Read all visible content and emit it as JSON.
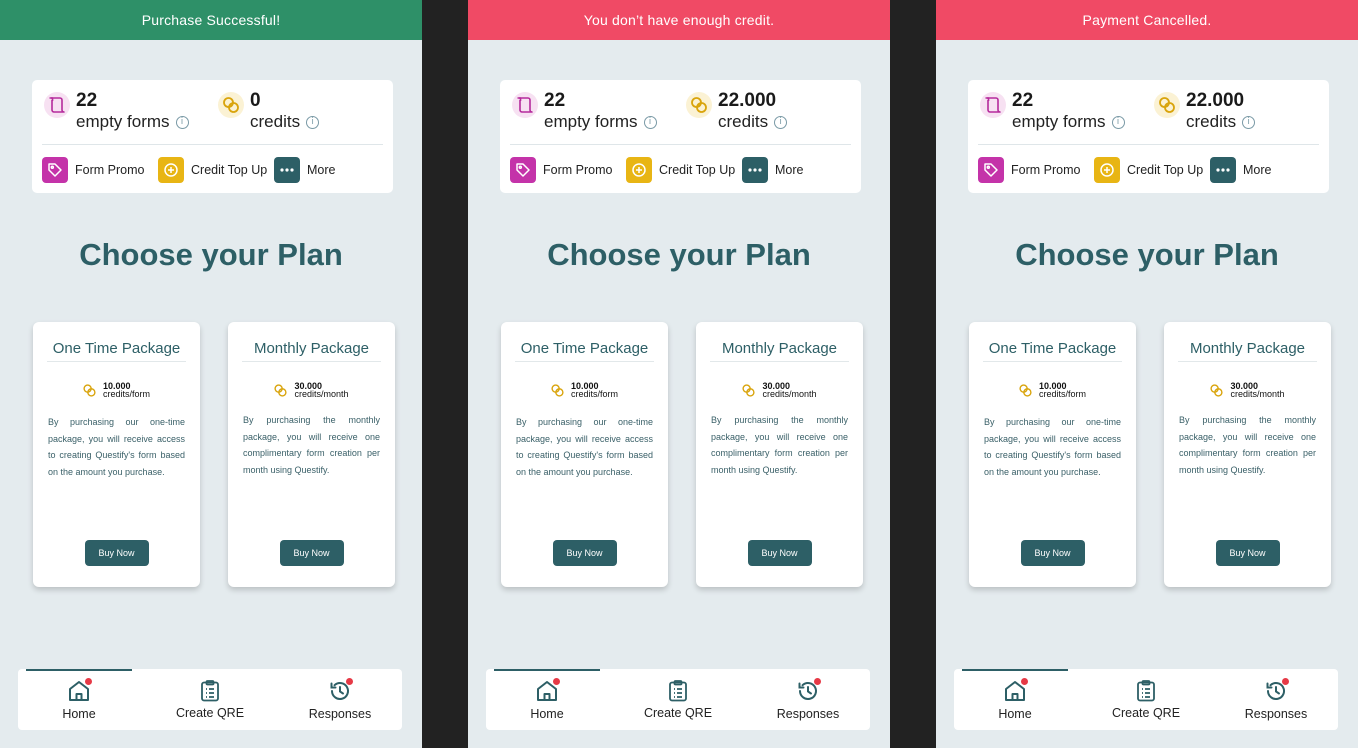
{
  "colors": {
    "success": "#2e9068",
    "error": "#f04a65",
    "primary": "#2d5f66",
    "form_accent": "#c433a9",
    "credit_accent": "#e8b514",
    "background": "#e4ebee"
  },
  "screens": [
    {
      "banner": {
        "text": "Purchase Successful!",
        "color": "#2e9068"
      },
      "stats": {
        "forms": {
          "value": "22",
          "label": "empty forms",
          "icon": "form-icon"
        },
        "credits": {
          "value": "0",
          "label": "credits",
          "icon": "coins-icon"
        }
      },
      "actions": [
        {
          "label": "Form Promo",
          "icon": "tag-icon"
        },
        {
          "label": "Credit Top Up",
          "icon": "plus-circle-icon"
        },
        {
          "label": "More",
          "icon": "more-icon"
        }
      ],
      "plan_title": "Choose your Plan",
      "packages": [
        {
          "title": "One Time Package",
          "amount": "10.000",
          "unit": "credits/form",
          "description": "By purchasing our one-time package, you will receive access to creating Questify's form based on the amount you purchase.",
          "button": "Buy Now"
        },
        {
          "title": "Monthly Package",
          "amount": "30.000",
          "unit": "credits/month",
          "description": "By purchasing the monthly package, you will receive one complimentary form creation per month using Questify.",
          "button": "Buy Now"
        }
      ],
      "nav": [
        {
          "label": "Home",
          "icon": "home-icon"
        },
        {
          "label": "Create QRE",
          "icon": "clipboard-icon"
        },
        {
          "label": "Responses",
          "icon": "history-icon"
        }
      ]
    },
    {
      "banner": {
        "text": "You don’t have enough credit.",
        "color": "#f04a65"
      },
      "stats": {
        "forms": {
          "value": "22",
          "label": "empty forms",
          "icon": "form-icon"
        },
        "credits": {
          "value": "22.000",
          "label": "credits",
          "icon": "coins-icon"
        }
      },
      "actions": [
        {
          "label": "Form Promo",
          "icon": "tag-icon"
        },
        {
          "label": "Credit Top Up",
          "icon": "plus-circle-icon"
        },
        {
          "label": "More",
          "icon": "more-icon"
        }
      ],
      "plan_title": "Choose your Plan",
      "packages": [
        {
          "title": "One Time Package",
          "amount": "10.000",
          "unit": "credits/form",
          "description": "By purchasing our one-time package, you will receive access to creating Questify's form based on the amount you purchase.",
          "button": "Buy Now"
        },
        {
          "title": "Monthly Package",
          "amount": "30.000",
          "unit": "credits/month",
          "description": "By purchasing the monthly package, you will receive one complimentary form creation per month using Questify.",
          "button": "Buy Now"
        }
      ],
      "nav": [
        {
          "label": "Home",
          "icon": "home-icon"
        },
        {
          "label": "Create QRE",
          "icon": "clipboard-icon"
        },
        {
          "label": "Responses",
          "icon": "history-icon"
        }
      ]
    },
    {
      "banner": {
        "text": "Payment Cancelled.",
        "color": "#f04a65"
      },
      "stats": {
        "forms": {
          "value": "22",
          "label": "empty forms",
          "icon": "form-icon"
        },
        "credits": {
          "value": "22.000",
          "label": "credits",
          "icon": "coins-icon"
        }
      },
      "actions": [
        {
          "label": "Form Promo",
          "icon": "tag-icon"
        },
        {
          "label": "Credit Top Up",
          "icon": "plus-circle-icon"
        },
        {
          "label": "More",
          "icon": "more-icon"
        }
      ],
      "plan_title": "Choose your Plan",
      "packages": [
        {
          "title": "One Time Package",
          "amount": "10.000",
          "unit": "credits/form",
          "description": "By purchasing our one-time package, you will receive access to creating Questify's form based on the amount you purchase.",
          "button": "Buy Now"
        },
        {
          "title": "Monthly Package",
          "amount": "30.000",
          "unit": "credits/month",
          "description": "By purchasing the monthly package, you will receive one complimentary form creation per month using Questify.",
          "button": "Buy Now"
        }
      ],
      "nav": [
        {
          "label": "Home",
          "icon": "home-icon"
        },
        {
          "label": "Create QRE",
          "icon": "clipboard-icon"
        },
        {
          "label": "Responses",
          "icon": "history-icon"
        }
      ]
    }
  ]
}
